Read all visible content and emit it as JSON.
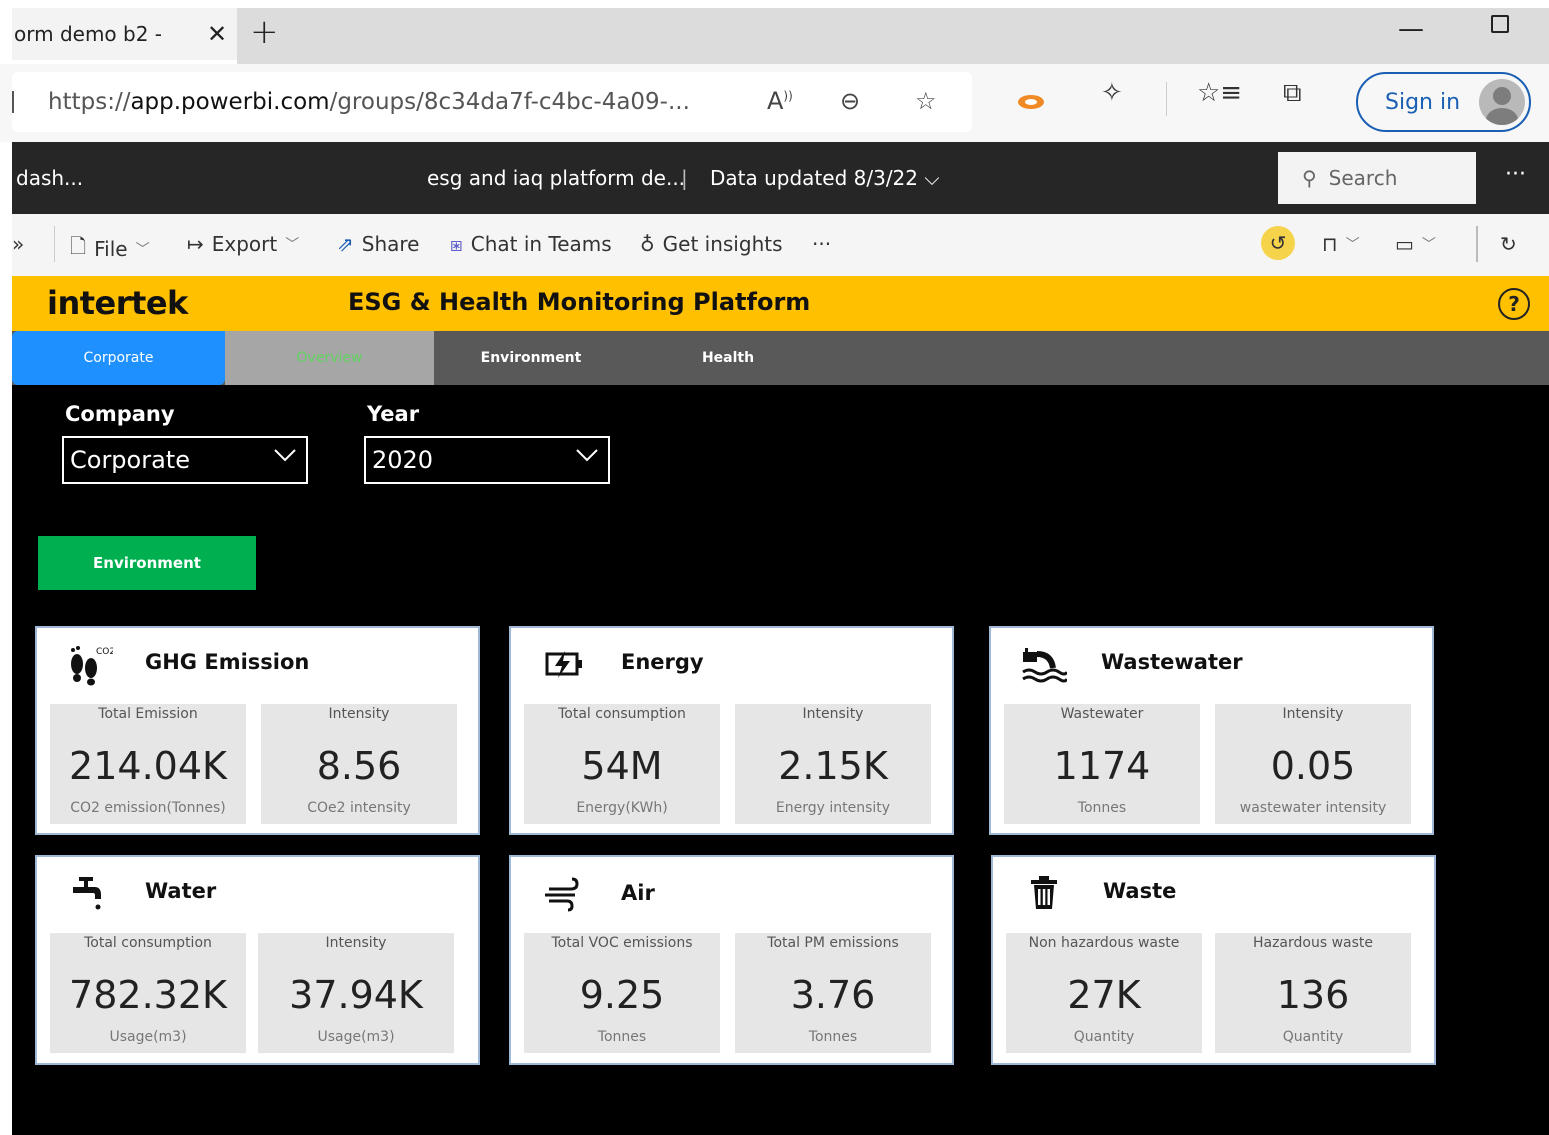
{
  "browser": {
    "tab_title": "orm demo b2 -",
    "tab_close": "✕",
    "new_tab": "+",
    "url_prefix": "https://",
    "url_host": "app.powerbi.com",
    "url_path": "/groups/8c34da7f-c4bc-4a09-...",
    "sign_in": "Sign in"
  },
  "pbi_header": {
    "breadcrumb": "dash...",
    "report_name": "esg and iaq platform de...",
    "separator": "|",
    "data_updated": "Data updated 8/3/22",
    "search_placeholder": "Search",
    "more": "···"
  },
  "toolbar": {
    "expand": "»",
    "file": "File",
    "export": "Export",
    "share": "Share",
    "chat_in_teams": "Chat in Teams",
    "get_insights": "Get insights",
    "more": "···"
  },
  "report": {
    "logo": "intertek",
    "title": "ESG & Health Monitoring Platform",
    "help": "?",
    "nav": [
      "Corporate",
      "Overview",
      "Environment",
      "Health"
    ],
    "company_label": "Company",
    "company_value": "Corporate",
    "year_label": "Year",
    "year_value": "2020",
    "environment_button": "Environment"
  },
  "cards": [
    {
      "title": "GHG Emission",
      "icon": "footprint-co2-icon",
      "metrics": [
        {
          "label": "Total Emission",
          "value": "214.04K",
          "unit": "CO2 emission(Tonnes)"
        },
        {
          "label": "Intensity",
          "value": "8.56",
          "unit": "COe2 intensity"
        }
      ]
    },
    {
      "title": "Energy",
      "icon": "battery-charging-icon",
      "metrics": [
        {
          "label": "Total consumption",
          "value": "54M",
          "unit": "Energy(KWh)"
        },
        {
          "label": "Intensity",
          "value": "2.15K",
          "unit": "Energy intensity"
        }
      ]
    },
    {
      "title": "Wastewater",
      "icon": "wastewater-pipe-icon",
      "metrics": [
        {
          "label": "Wastewater",
          "value": "1174",
          "unit": "Tonnes"
        },
        {
          "label": "Intensity",
          "value": "0.05",
          "unit": "wastewater intensity"
        }
      ]
    },
    {
      "title": "Water",
      "icon": "faucet-icon",
      "metrics": [
        {
          "label": "Total consumption",
          "value": "782.32K",
          "unit": "Usage(m3)"
        },
        {
          "label": "Intensity",
          "value": "37.94K",
          "unit": "Usage(m3)"
        }
      ]
    },
    {
      "title": "Air",
      "icon": "wind-icon",
      "metrics": [
        {
          "label": "Total VOC emissions",
          "value": "9.25",
          "unit": "Tonnes"
        },
        {
          "label": "Total PM emissions",
          "value": "3.76",
          "unit": "Tonnes"
        }
      ]
    },
    {
      "title": "Waste",
      "icon": "trash-bin-icon",
      "metrics": [
        {
          "label": "Non hazardous waste",
          "value": "27K",
          "unit": "Quantity"
        },
        {
          "label": "Hazardous waste",
          "value": "136",
          "unit": "Quantity"
        }
      ]
    }
  ],
  "colors": {
    "banner": "#ffc000",
    "nav_active": "#1e90ff",
    "env_button": "#00b050",
    "canvas": "#000000"
  }
}
